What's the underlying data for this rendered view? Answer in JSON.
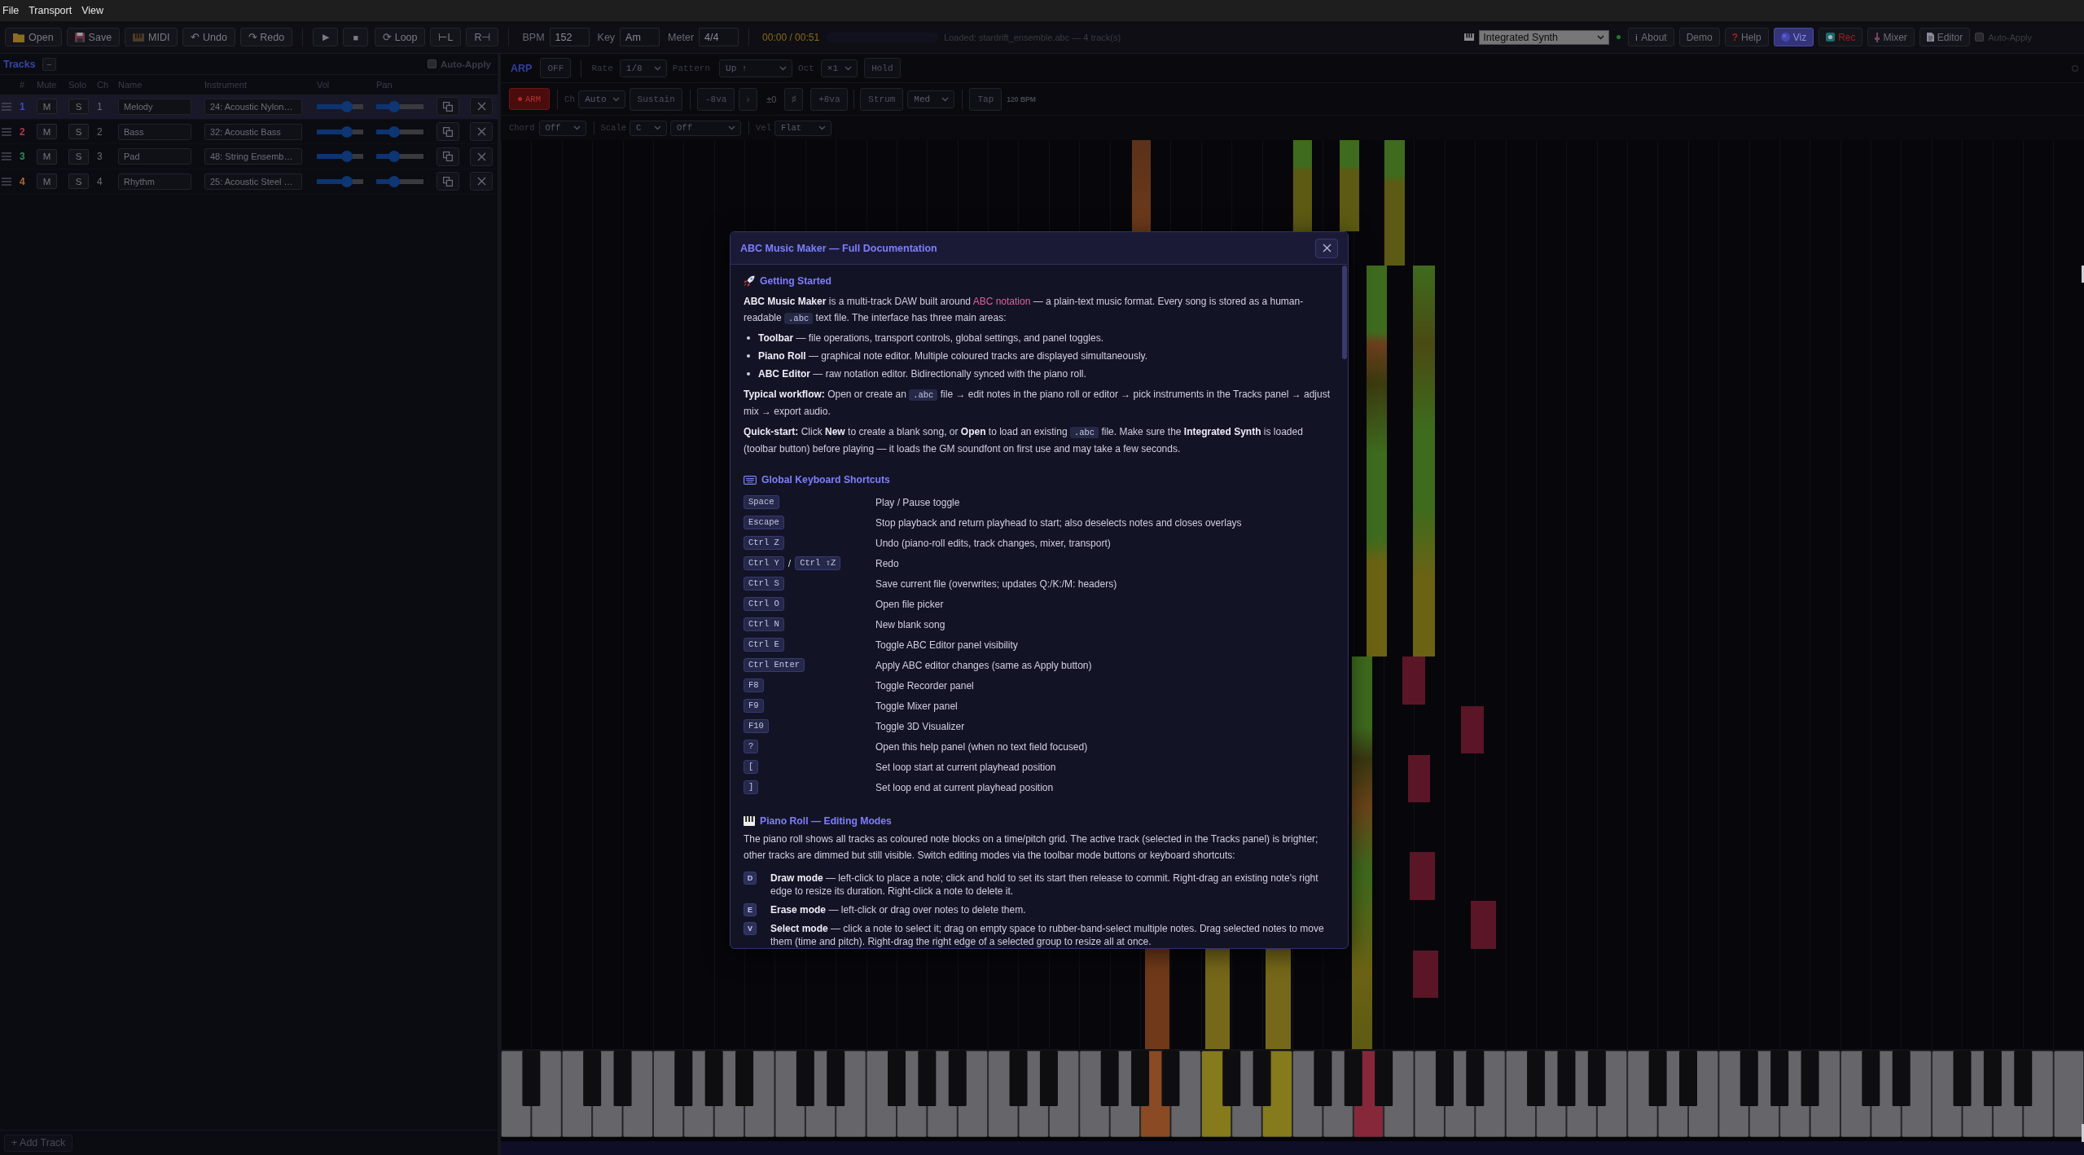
{
  "menu_bar": [
    {
      "label": "File"
    },
    {
      "label": "Transport"
    },
    {
      "label": "View"
    }
  ],
  "toolbar": {
    "file_buttons": [
      {
        "kind": "open",
        "label": "Open"
      },
      {
        "kind": "save",
        "label": "Save"
      },
      {
        "kind": "midi",
        "label": "MIDI"
      },
      {
        "kind": "undo",
        "label": "↶ Undo"
      },
      {
        "kind": "redo",
        "label": "↷ Redo"
      }
    ],
    "transport": [
      {
        "kind": "play",
        "label": "▶"
      },
      {
        "kind": "stop",
        "label": "■"
      },
      {
        "kind": "loop",
        "label": "⟳ Loop"
      },
      {
        "kind": "loop_start",
        "label": "⊢L"
      },
      {
        "kind": "loop_end",
        "label": "R⊣"
      }
    ],
    "fields": [
      {
        "label": "BPM",
        "value": "152"
      },
      {
        "label": "Key",
        "value": "Am"
      },
      {
        "label": "Meter",
        "value": "4/4"
      }
    ],
    "time": "00:00 / 00:51",
    "status": "Loaded: stardrift_ensemble.abc — 4 track(s)",
    "synth": {
      "value": "Integrated Synth",
      "ready": true
    },
    "panel_buttons": [
      {
        "kind": "about",
        "icon": "ℹ",
        "label": "About",
        "selected": false
      },
      {
        "kind": "demo",
        "label": "Demo",
        "selected": false
      },
      {
        "kind": "help",
        "icon": "?",
        "label": "Help",
        "selected": false
      },
      {
        "kind": "viz",
        "label": "Viz",
        "selected": true
      },
      {
        "kind": "rec",
        "label": "Rec",
        "selected": false
      },
      {
        "kind": "mixer",
        "label": "Mixer",
        "selected": false
      },
      {
        "kind": "editor",
        "label": "Editor",
        "selected": false
      }
    ],
    "auto_apply": {
      "label": "Auto-Apply",
      "checked": false
    }
  },
  "tracks_panel": {
    "title": "Tracks",
    "collapse": "−",
    "auto_apply": {
      "label": "Auto-Apply",
      "checked": false
    },
    "columns": [
      "#",
      "Mute",
      "Solo",
      "Ch",
      "Name",
      "Instrument",
      "Vol",
      "Pan"
    ],
    "rows": [
      {
        "number": "1",
        "color": "#3b4cc4",
        "mute": {
          "label": "M",
          "on": false
        },
        "solo": {
          "label": "S",
          "on": false
        },
        "channel": "1",
        "name": "Melody",
        "instrument": "24: Acoustic Nylon…",
        "vol": {
          "level": 0.78
        },
        "pan": {
          "level": 0.5
        },
        "selected": true
      },
      {
        "number": "2",
        "color": "#b0394a",
        "mute": {
          "label": "M",
          "on": false
        },
        "solo": {
          "label": "S",
          "on": false
        },
        "channel": "2",
        "name": "Bass",
        "instrument": "32: Acoustic Bass",
        "vol": {
          "level": 0.78
        },
        "pan": {
          "level": 0.5
        },
        "selected": false
      },
      {
        "number": "3",
        "color": "#2f8f4f",
        "mute": {
          "label": "M",
          "on": false
        },
        "solo": {
          "label": "S",
          "on": false
        },
        "channel": "3",
        "name": "Pad",
        "instrument": "48: String Ensemb…",
        "vol": {
          "level": 0.78
        },
        "pan": {
          "level": 0.5
        },
        "selected": false
      },
      {
        "number": "4",
        "color": "#b86a2c",
        "mute": {
          "label": "M",
          "on": false
        },
        "solo": {
          "label": "S",
          "on": false
        },
        "channel": "4",
        "name": "Rhythm",
        "instrument": "25: Acoustic Steel …",
        "vol": {
          "level": 0.78
        },
        "pan": {
          "level": 0.5
        },
        "selected": false
      }
    ],
    "add_button": "+ Add Track"
  },
  "arp_bar": {
    "title": "ARP",
    "toggle": {
      "label": "OFF",
      "on": false
    },
    "rate": {
      "label": "Rate",
      "value": "1/8"
    },
    "pattern": {
      "label": "Pattern",
      "value": "Up ↑"
    },
    "octave": {
      "label": "Oct",
      "value": "×1"
    },
    "hold": {
      "label": "Hold",
      "on": false
    }
  },
  "input_bar": {
    "arm": "ARM",
    "channel": {
      "label": "Ch",
      "value": "Auto"
    },
    "sustain": {
      "label": "Sustain",
      "on": false
    },
    "octave_down": "-8va",
    "flat": "♭",
    "transpose": "±0",
    "sharp": "♯",
    "octave_up": "+8va",
    "strum": {
      "label": "Strum",
      "on": false
    },
    "strum_speed": "Med",
    "tap": "Tap",
    "tempo": "120 BPM"
  },
  "chord_bar": {
    "chord": {
      "label": "Chord",
      "value": "Off"
    },
    "scale": {
      "label": "Scale",
      "root": "C",
      "mode": "Off"
    },
    "velocity": {
      "label": "Vel",
      "value": "Flat"
    }
  },
  "help_dialog": {
    "title": "ABC Music Maker — Full Documentation",
    "sections": [
      {
        "heading": "Getting Started",
        "blocks": [
          {
            "kind": "paragraph",
            "runs": [
              {
                "kind": "text",
                "text": "**ABC Music Maker** is a multi-track DAW built around "
              },
              {
                "kind": "link",
                "text": "ABC notation"
              },
              {
                "kind": "text",
                "text": " — a plain-text music format. Every song is stored as a human-readable "
              },
              {
                "kind": "code",
                "text": ".abc"
              },
              {
                "kind": "text",
                "text": " text file. The interface has three main areas:"
              }
            ]
          },
          {
            "kind": "bullets",
            "items": [
              "**Toolbar** — file operations, transport controls, global settings, and panel toggles.",
              "**Piano Roll** — graphical note editor. Multiple coloured tracks are displayed simultaneously.",
              "**ABC Editor** — raw notation editor. Bidirectionally synced with the piano roll."
            ]
          },
          {
            "kind": "paragraph",
            "runs": [
              {
                "kind": "text",
                "text": "**Typical workflow:** Open or create an "
              },
              {
                "kind": "code",
                "text": ".abc"
              },
              {
                "kind": "text",
                "text": " file → edit notes in the piano roll or editor → pick instruments in the Tracks panel → adjust mix → export audio."
              }
            ]
          },
          {
            "kind": "paragraph",
            "runs": [
              {
                "kind": "text",
                "text": "**Quick-start:** Click **New** to create a blank song, or **Open** to load an existing "
              },
              {
                "kind": "code",
                "text": ".abc"
              },
              {
                "kind": "text",
                "text": " file. Make sure the **Integrated Synth** is loaded (toolbar button) before playing — it loads the GM soundfont on first use and may take a few seconds."
              }
            ]
          }
        ]
      },
      {
        "heading": "Global Keyboard Shortcuts",
        "blocks": [
          {
            "kind": "shortcuts",
            "rows": [
              {
                "keys": [
                  "Space"
                ],
                "action": "Play / Pause toggle"
              },
              {
                "keys": [
                  "Escape"
                ],
                "action": "Stop playback and return playhead to start; also deselects notes and closes overlays"
              },
              {
                "keys": [
                  "Ctrl Z"
                ],
                "action": "Undo (piano-roll edits, track changes, mixer, transport)"
              },
              {
                "keys": [
                  "Ctrl Y",
                  "Ctrl ⇧Z"
                ],
                "separator": "/",
                "action": "Redo"
              },
              {
                "keys": [
                  "Ctrl S"
                ],
                "action": "Save current file (overwrites; updates Q:/K:/M: headers)"
              },
              {
                "keys": [
                  "Ctrl O"
                ],
                "action": "Open file picker"
              },
              {
                "keys": [
                  "Ctrl N"
                ],
                "action": "New blank song"
              },
              {
                "keys": [
                  "Ctrl E"
                ],
                "action": "Toggle ABC Editor panel visibility"
              },
              {
                "keys": [
                  "Ctrl Enter"
                ],
                "action": "Apply ABC editor changes (same as Apply button)"
              },
              {
                "keys": [
                  "F8"
                ],
                "action": "Toggle Recorder panel"
              },
              {
                "keys": [
                  "F9"
                ],
                "action": "Toggle Mixer panel"
              },
              {
                "keys": [
                  "F10"
                ],
                "action": "Toggle 3D Visualizer"
              },
              {
                "keys": [
                  "?"
                ],
                "action": "Open this help panel (when no text field focused)"
              },
              {
                "keys": [
                  "["
                ],
                "action": "Set loop start at current playhead position"
              },
              {
                "keys": [
                  "]"
                ],
                "action": "Set loop end at current playhead position"
              }
            ]
          }
        ]
      },
      {
        "heading": "Piano Roll — Editing Modes",
        "blocks": [
          {
            "kind": "paragraph",
            "runs": [
              {
                "kind": "text",
                "text": "The piano roll shows all tracks as coloured note blocks on a time/pitch grid. The active track (selected in the Tracks panel) is brighter; other tracks are dimmed but still visible. Switch editing modes via the toolbar mode buttons or keyboard shortcuts:"
              }
            ]
          },
          {
            "kind": "modes",
            "items": [
              {
                "key": "D",
                "text": "**Draw mode** — left-click to place a note; click and hold to set its start then release to commit. Right-drag an existing note's right edge to resize its duration. Right-click a note to delete it."
              },
              {
                "key": "E",
                "text": "**Erase mode** — left-click or drag over notes to delete them."
              },
              {
                "key": "V",
                "text": "**Select mode** — click a note to select it; drag on empty space to rubber-band-select multiple notes. Drag selected notes to move them (time and pitch). Right-drag the right edge of a selected group to resize all at once."
              }
            ]
          }
        ]
      }
    ]
  }
}
